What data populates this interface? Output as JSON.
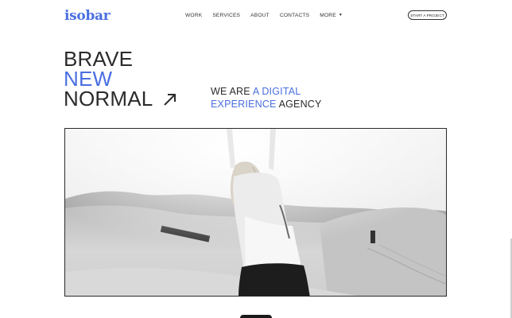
{
  "header": {
    "logo": "isobar",
    "nav": [
      {
        "label": "WORK"
      },
      {
        "label": "SERVICES"
      },
      {
        "label": "ABOUT"
      },
      {
        "label": "CONTACTS"
      },
      {
        "label": "MORE"
      }
    ],
    "cta_label": "START A PROJECT"
  },
  "hero": {
    "headline": {
      "line1": "BRAVE",
      "line2": "NEW",
      "line3": "NORMAL"
    },
    "tagline": {
      "part1": "WE ARE ",
      "part2": "A DIGITAL",
      "part3": "EXPERIENCE",
      "part4": " AGENCY"
    },
    "arrow_icon": "arrow-up-right-icon",
    "image_icon": "photo-woman-arms-raised-desert"
  },
  "colors": {
    "accent": "#4a6fe0",
    "text": "#2b2b2b",
    "background": "#ffffff"
  }
}
